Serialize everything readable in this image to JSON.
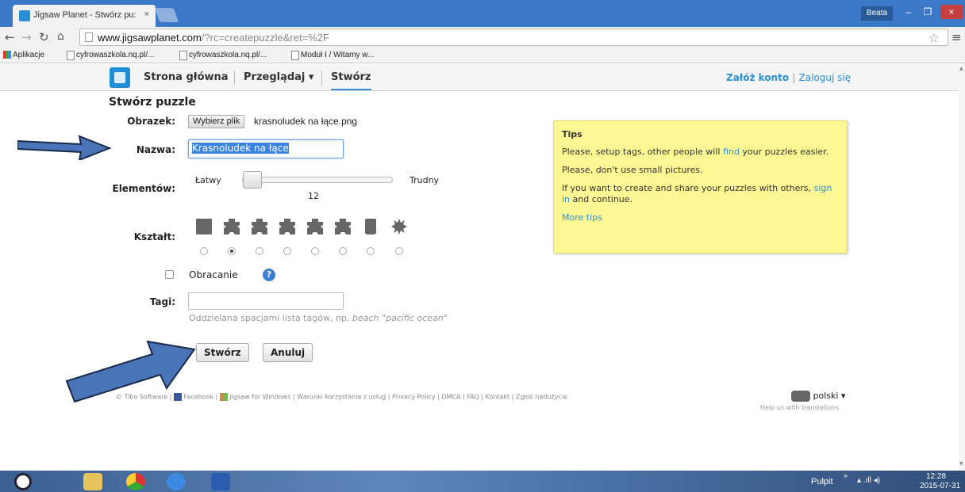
{
  "browser": {
    "tab_title": "Jigsaw Planet - Stwórz pu:",
    "tab_close": "×",
    "user_badge": "Beata",
    "win_minimize": "–",
    "win_maximize": "❐",
    "win_close": "×",
    "url_host": "www.jigsawplanet.com",
    "url_path": "/?rc=createpuzzle&ret=%2F",
    "bookmarks": [
      "Aplikacje",
      "cyfrowaszkola.nq.pl/...",
      "cyfrowaszkola.nq.pl/...",
      "Moduł I / Witamy w..."
    ]
  },
  "site_nav": {
    "home": "Strona główna",
    "browse": "Przeglądaj ▾",
    "create": "Stwórz",
    "register": "Załóż konto",
    "separator": "|",
    "login": "Zaloguj się"
  },
  "form": {
    "title": "Stwórz puzzle",
    "image_label": "Obrazek:",
    "file_button": "Wybierz plik",
    "file_name": "krasnoludek na łące.png",
    "name_label": "Nazwa:",
    "name_value": "Krasnoludek na łące",
    "pieces_label": "Elementów:",
    "slider_easy": "Łatwy",
    "slider_hard": "Trudny",
    "pieces_value": "12",
    "shape_label": "Kształt:",
    "selected_shape_index": 1,
    "rotate_label": "Obracanie",
    "rotate_checked": false,
    "help_glyph": "?",
    "tags_label": "Tagi:",
    "tags_value": "",
    "tags_hint": "Oddzielana spacjami lista tagów, np.",
    "tags_hint_example": "beach \"pacific ocean\"",
    "create_button": "Stwórz",
    "cancel_button": "Anuluj"
  },
  "tips": {
    "title": "Tips",
    "line1_a": "Please, setup tags, other people will ",
    "line1_link": "find",
    "line1_b": " your puzzles easier.",
    "line2": "Please, don't use small pictures.",
    "line3_a": "If you want to create and share your puzzles with others, ",
    "line3_link": "sign in",
    "line3_b": " and continue.",
    "more": "More tips"
  },
  "footer": {
    "copyright": "© Tibo Software",
    "facebook": "Facebook",
    "windows": "Jigsaw for Windows",
    "terms": "Warunki korzystania z usług",
    "privacy": "Privacy Policy",
    "dmca": "DMCA",
    "faq": "FAQ",
    "contact": "Kontakt",
    "report": "Zgłoś nadużycie",
    "language": "polski ▾",
    "translate_help": "Help us with translations"
  },
  "taskbar": {
    "desktop_label": "Pulpit",
    "chevron": "»",
    "time": "12:28",
    "date": "2015-07-31"
  },
  "colors": {
    "accent": "#2d8fd6",
    "tips_bg": "#fdf794",
    "arrow": "#4a74b8"
  }
}
